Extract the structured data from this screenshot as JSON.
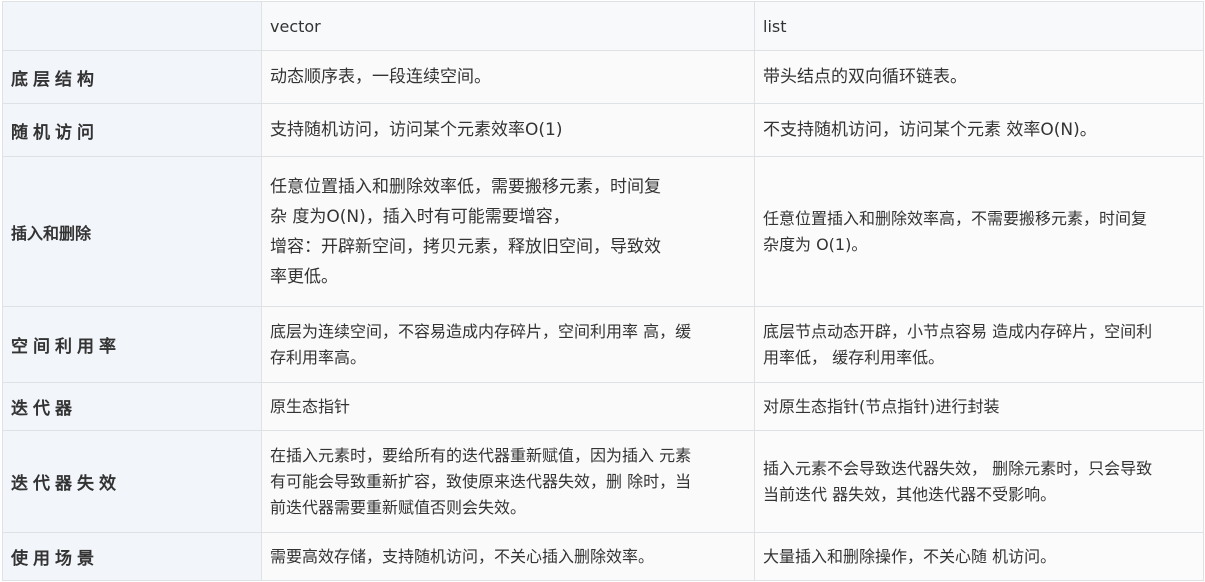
{
  "table": {
    "headers": [
      "",
      "vector",
      "list"
    ],
    "rows": [
      {
        "label": "底层结构",
        "vector": "动态顺序表，一段连续空间。",
        "list": "带头结点的双向循环链表。"
      },
      {
        "label": "随机访问",
        "vector": "支持随机访问，访问某个元素效率O(1)",
        "list": "不支持随机访问，访问某个元素 效率O(N)。"
      },
      {
        "label": "插入和删除",
        "vector_lines": [
          "任意位置插入和删除效率低，需要搬移元素，时间复",
          "杂 度为O(N)，插入时有可能需要增容，",
          "增容：开辟新空间，拷贝元素，释放旧空间，导致效",
          "率更低。"
        ],
        "list_lines": [
          "任意位置插入和删除效率高，不需要搬移元素，时间复",
          "杂度为 O(1)。"
        ]
      },
      {
        "label": "空间利用率",
        "vector_lines": [
          "底层为连续空间，不容易造成内存碎片，空间利用率 高，缓",
          "存利用率高。"
        ],
        "list_lines": [
          "底层节点动态开辟，小节点容易 造成内存碎片，空间利",
          "用率低， 缓存利用率低。"
        ]
      },
      {
        "label": "迭代器",
        "vector": "原生态指针",
        "list": " 对原生态指针(节点指针)进行封装"
      },
      {
        "label": "迭代器失效",
        "vector_lines": [
          "在插入元素时，要给所有的迭代器重新赋值，因为插入 元素",
          "有可能会导致重新扩容，致使原来迭代器失效，删 除时，当",
          "前迭代器需要重新赋值否则会失效。"
        ],
        "list_lines": [
          "插入元素不会导致迭代器失效， 删除元素时，只会导致",
          "当前迭代 器失效，其他迭代器不受影响。"
        ]
      },
      {
        "label": "使用场景",
        "vector": "需要高效存储，支持随机访问，不关心插入删除效率。",
        "list": "大量插入和删除操作，不关心随 机访问。"
      }
    ]
  }
}
